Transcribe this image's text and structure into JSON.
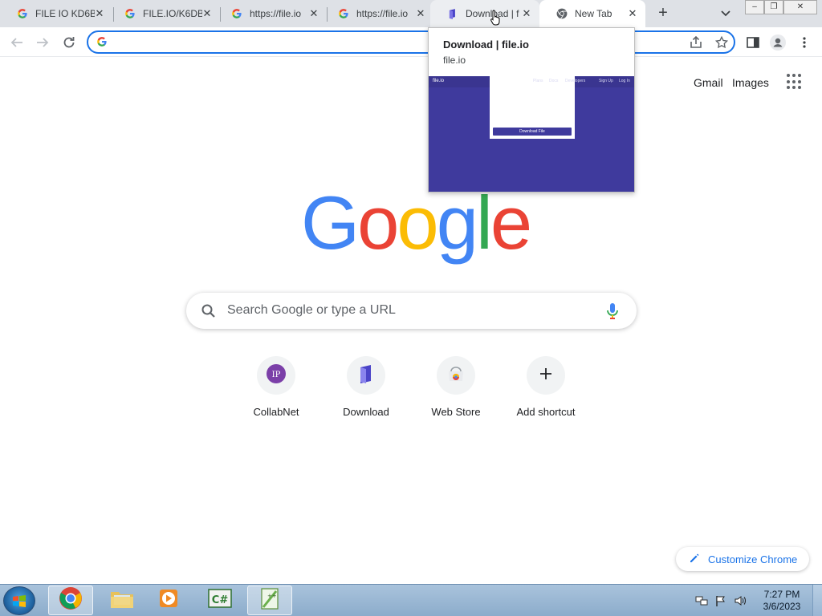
{
  "tabs": [
    {
      "title": "FILE IO KD6B",
      "favicon": "google-g-icon"
    },
    {
      "title": "FILE.IO/K6DB",
      "favicon": "google-g-icon"
    },
    {
      "title": "https://file.io",
      "favicon": "google-g-icon"
    },
    {
      "title": "https://file.io",
      "favicon": "google-g-icon"
    },
    {
      "title": "Download | f",
      "favicon": "fileio-icon"
    },
    {
      "title": "New Tab",
      "favicon": "chrome-icon"
    }
  ],
  "window_controls": {
    "minimize": "–",
    "restore": "❐",
    "close": "✕"
  },
  "omnibox": {
    "value": "",
    "placeholder": ""
  },
  "top_links": {
    "gmail": "Gmail",
    "images": "Images"
  },
  "logo_letters": [
    {
      "ch": "G",
      "color": "#4285f4"
    },
    {
      "ch": "o",
      "color": "#ea4335"
    },
    {
      "ch": "o",
      "color": "#fbbc05"
    },
    {
      "ch": "g",
      "color": "#4285f4"
    },
    {
      "ch": "l",
      "color": "#34a853"
    },
    {
      "ch": "e",
      "color": "#ea4335"
    }
  ],
  "search": {
    "placeholder": "Search Google or type a URL"
  },
  "shortcuts": [
    {
      "label": "CollabNet",
      "icon": "collabnet-icon"
    },
    {
      "label": "Download",
      "icon": "fileio-icon"
    },
    {
      "label": "Web Store",
      "icon": "webstore-icon"
    },
    {
      "label": "Add shortcut",
      "icon": "plus-icon"
    }
  ],
  "customize": {
    "label": "Customize Chrome"
  },
  "hovercard": {
    "title": "Download | file.io",
    "domain": "file.io",
    "preview": {
      "logo": "file.io",
      "nav_links": [
        "Plans",
        "Docs",
        "Developers",
        "Sign Up",
        "Log In"
      ],
      "download_button": "Download File"
    }
  },
  "taskbar": {
    "time": "7:27 PM",
    "date": "3/6/2023",
    "apps": [
      "chrome-icon",
      "file-explorer-icon",
      "media-player-icon",
      "csharp-icon",
      "notepad-plus-icon"
    ]
  },
  "colors": {
    "accent": "#1a73e8",
    "tabstrip": "#dee1e6",
    "fileio_purple": "#3f3a9d"
  }
}
